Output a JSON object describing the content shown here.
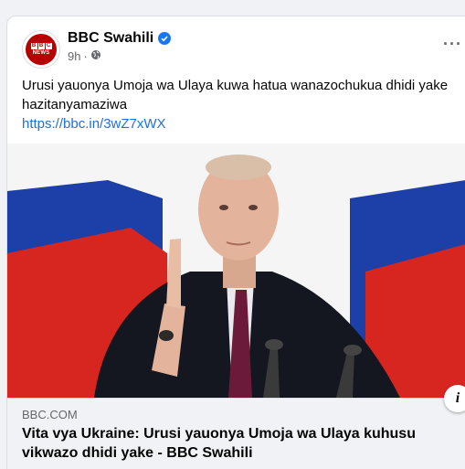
{
  "post": {
    "page_name": "BBC Swahili",
    "time": "9h",
    "audience_icon": "globe-icon",
    "text": "Urusi yauonya Umoja wa Ulaya kuwa hatua wanazochukua dhidi yake hazitanyamaziwa",
    "link": "https://bbc.in/3wZ7xWX"
  },
  "avatar": {
    "letters": [
      "B",
      "B",
      "C"
    ],
    "word": "NEWS"
  },
  "link_preview": {
    "domain": "BBC.COM",
    "headline": "Vita vya Ukraine: Urusi yauonya Umoja wa Ulaya kuhusu vikwazo dhidi yake - BBC Swahili"
  },
  "colors": {
    "bbc_red": "#b80000",
    "link_blue": "#216fdb",
    "verified_blue": "#1877f2",
    "flag_white": "#f5f5f5",
    "flag_blue": "#1c3fa8",
    "flag_red": "#d7261f"
  }
}
